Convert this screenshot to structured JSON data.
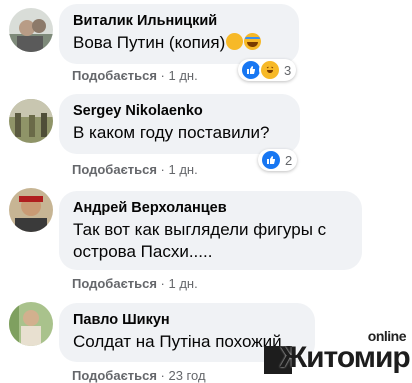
{
  "comments": [
    {
      "author": "Виталик Ильницкий",
      "text": "Вова Путин (копия)",
      "emoji": [
        "face-with-tears-of-joy",
        "loudly-crying-face"
      ],
      "like_label": "Подобається",
      "time": "1 дн.",
      "reactions": [
        "like-icon",
        "haha-icon"
      ],
      "reaction_count": "3"
    },
    {
      "author": "Sergey Nikolaenko",
      "text": "В каком году поставили?",
      "like_label": "Подобається",
      "time": "1 дн.",
      "reactions": [
        "like-icon"
      ],
      "reaction_count": "2"
    },
    {
      "author": "Андрей Верхоланцев",
      "text_line1": "Так вот как выглядели фигуры с",
      "text_line2": "острова Пасхи.....",
      "like_label": "Подобається",
      "time": "1 дн."
    },
    {
      "author": "Павло Шикун",
      "text": "Солдат на Путіна похожий",
      "like_label": "Подобається",
      "time": "23 год"
    }
  ],
  "watermark": {
    "top": "online",
    "name": "Житомир"
  },
  "colors": {
    "bubble": "#f0f2f5",
    "meta": "#65676b",
    "like_blue": "#1877f2",
    "haha_yellow": "#f7b928"
  }
}
